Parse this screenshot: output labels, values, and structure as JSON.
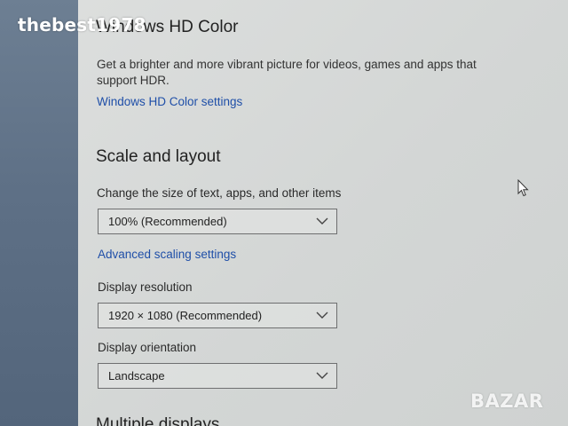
{
  "watermarks": {
    "top": "thebest1978",
    "bottom": "BAZAR"
  },
  "hdr": {
    "title": "Windows HD Color",
    "description": "Get a brighter and more vibrant picture for videos, games and apps that support HDR.",
    "settings_link": "Windows HD Color settings"
  },
  "scale_layout": {
    "title": "Scale and layout",
    "size_label": "Change the size of text, apps, and other items",
    "size_value": "100% (Recommended)",
    "advanced_link": "Advanced scaling settings",
    "resolution_label": "Display resolution",
    "resolution_value": "1920 × 1080 (Recommended)",
    "orientation_label": "Display orientation",
    "orientation_value": "Landscape"
  },
  "next_section": {
    "title_partial": "Multiple displays"
  },
  "icons": {
    "dropdown": "chevron-down-icon",
    "pointer": "mouse-cursor-icon"
  },
  "colors": {
    "link": "#1f4fa8",
    "text": "#222222",
    "sidebar": "#5e7086"
  }
}
